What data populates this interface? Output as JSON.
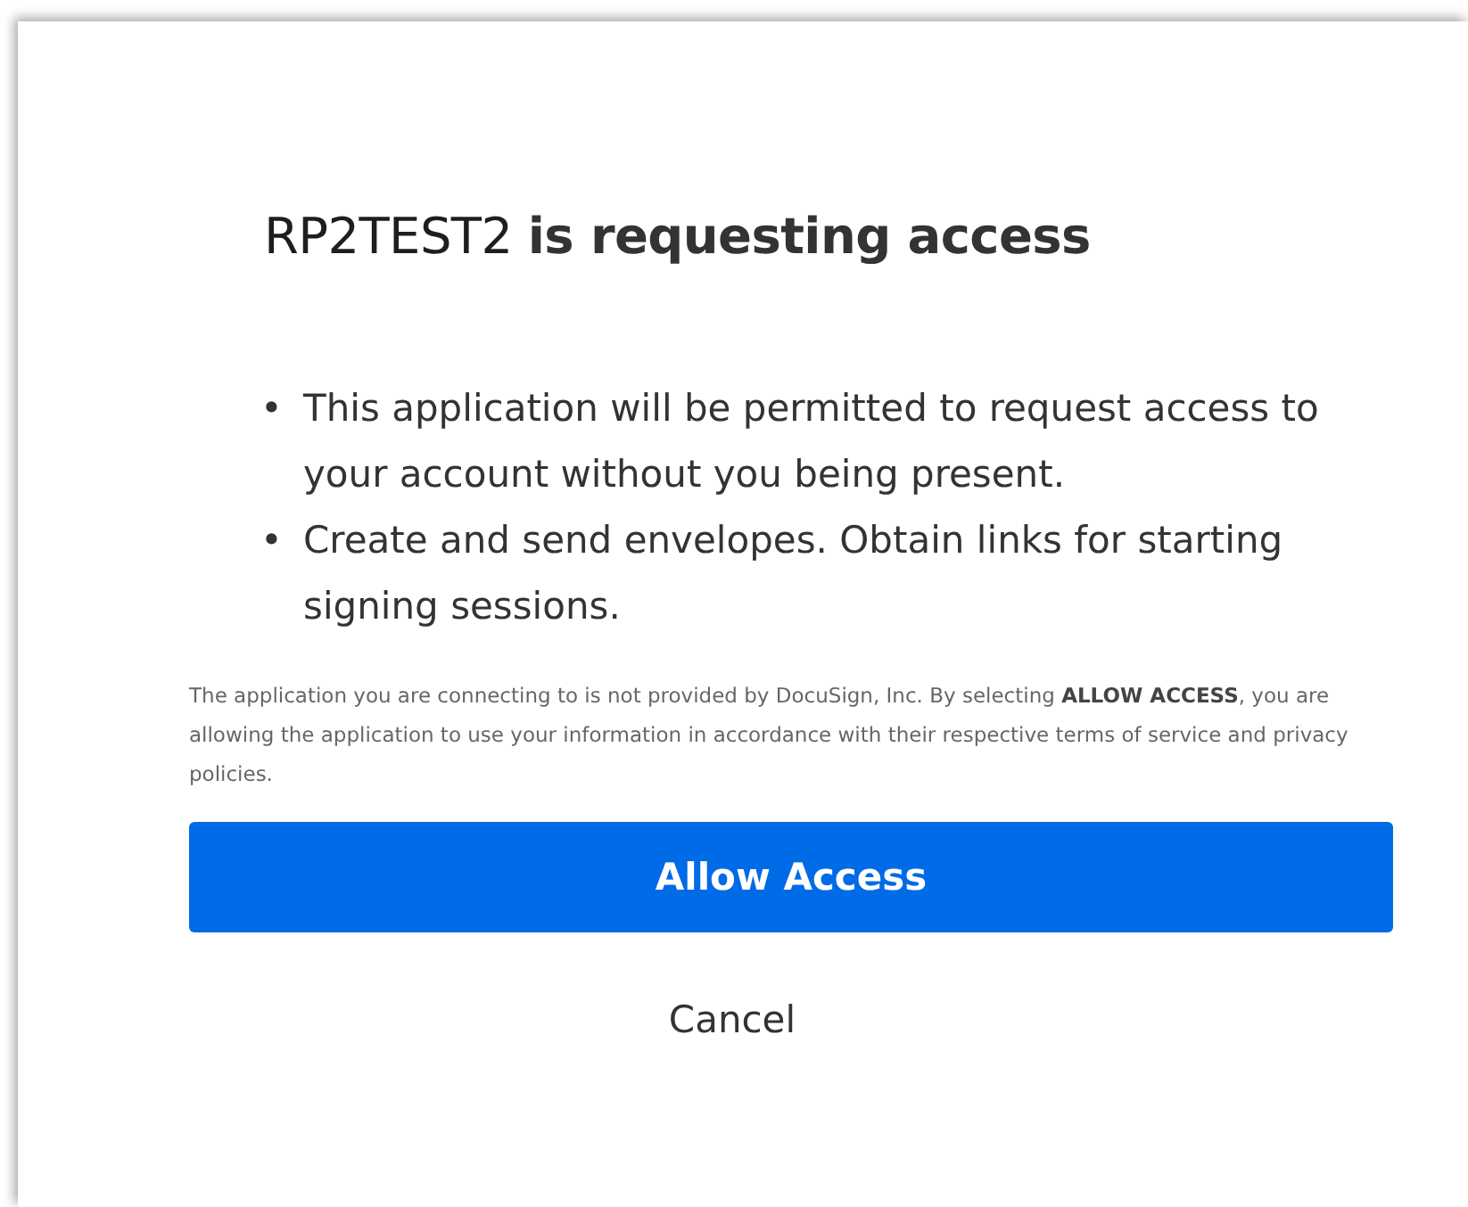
{
  "dialog": {
    "title": "RP2TEST2 **is requesting access**",
    "permissions": [
      {
        "marker": "•",
        "text": "This application will be permitted to request access to your account without you being present."
      },
      {
        "marker": "•",
        "text": "Create and send envelopes. Obtain links for starting signing sessions."
      }
    ],
    "disclaimer": "The application you are connecting to is not provided by DocuSign, Inc. By selecting **ALLOW ACCESS**, you are allowing the application to use your information in accordance with their respective terms of service and privacy policies.",
    "buttons": [
      {
        "kind": "primary",
        "label": "Allow Access"
      },
      {
        "kind": "text",
        "label": "Cancel"
      }
    ]
  }
}
